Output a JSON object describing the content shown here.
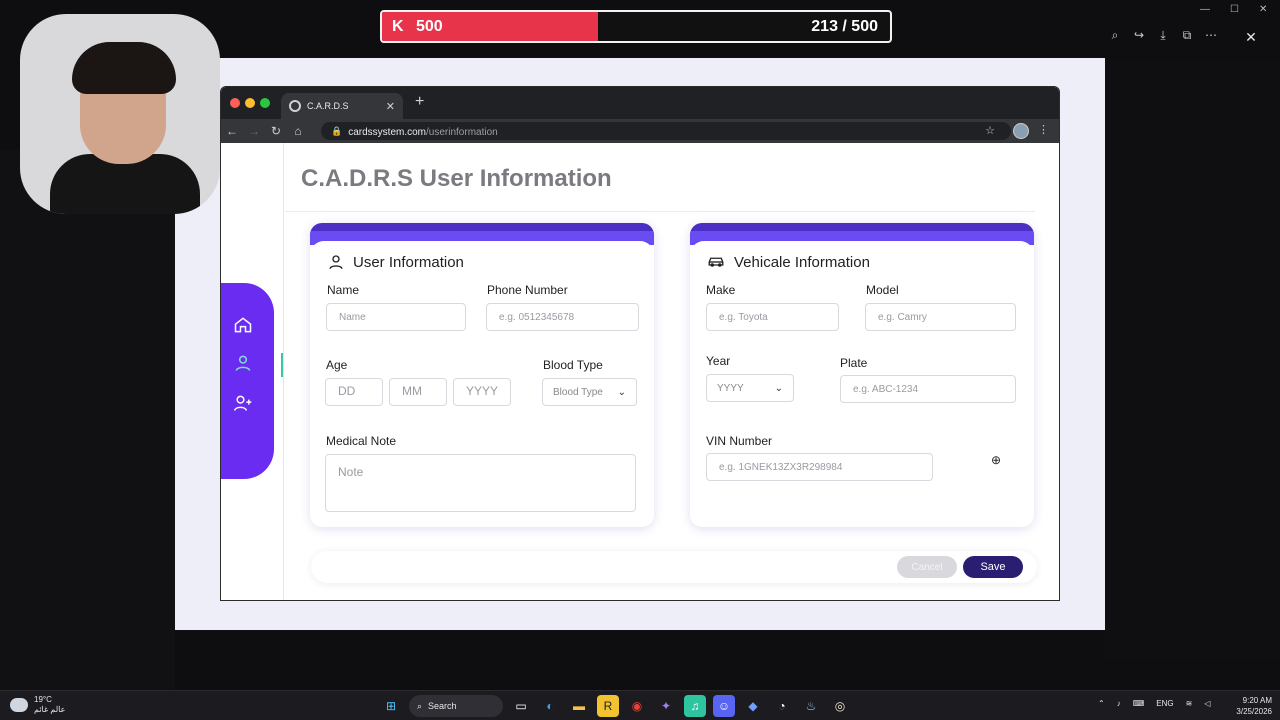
{
  "hud": {
    "brand_icon": "K",
    "left_value": "500",
    "counter": "213 / 500",
    "progress_fraction": 0.426,
    "accent": "#e8344a"
  },
  "browser": {
    "tab_title": "C.A.R.D.S",
    "url_host": "cardssystem.com",
    "url_path": "/userinformation"
  },
  "page": {
    "title": "C.A.D.R.S User Information",
    "sidebar": [
      "home-icon",
      "user-icon",
      "add-user-icon"
    ],
    "user_card": {
      "heading": "User Information",
      "name_label": "Name",
      "name_placeholder": "Name",
      "phone_label": "Phone Number",
      "phone_placeholder": "e.g. 0512345678",
      "age_label": "Age",
      "dd_placeholder": "DD",
      "mm_placeholder": "MM",
      "yyyy_placeholder": "YYYY",
      "blood_label": "Blood Type",
      "blood_value": "Blood Type",
      "note_label": "Medical Note",
      "note_placeholder": "Note"
    },
    "vehicle_card": {
      "heading": "Vehicale Information",
      "make_label": "Make",
      "make_placeholder": "e.g. Toyota",
      "model_label": "Model",
      "model_placeholder": "e.g. Camry",
      "year_label": "Year",
      "year_value": "YYYY",
      "plate_label": "Plate",
      "plate_placeholder": "e.g. ABC-1234",
      "vin_label": "VIN Number",
      "vin_placeholder": "e.g. 1GNEK13ZX3R298984"
    },
    "actions": {
      "cancel": "Cancel",
      "save": "Save"
    },
    "colors": {
      "sidebar": "#6a2cf0",
      "card_band": "#4b2ec4",
      "save": "#2a1e73"
    }
  },
  "taskbar": {
    "weather_temp": "19°C",
    "weather_text": "عالم غائم",
    "search_label": "Search",
    "lang": "ENG",
    "time": "9:20 AM",
    "date": "3/25/2026"
  }
}
